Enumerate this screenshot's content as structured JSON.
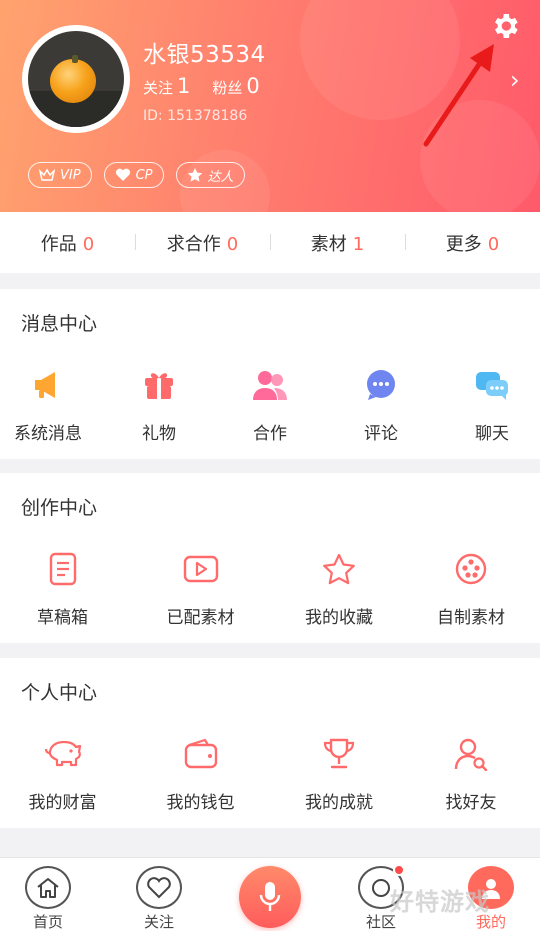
{
  "profile": {
    "username": "水银53534",
    "following_label": "关注",
    "following_count": "1",
    "fans_label": "粉丝",
    "fans_count": "0",
    "user_id": "ID: 151378186",
    "settings_icon": "gear-icon",
    "chevron": "›"
  },
  "badges": [
    {
      "label": "VIP",
      "icon": "crown-icon"
    },
    {
      "label": "CP",
      "icon": "heart-icon"
    },
    {
      "label": "达人",
      "icon": "star-icon"
    }
  ],
  "works_bar": [
    {
      "label": "作品",
      "count": "0"
    },
    {
      "label": "求合作",
      "count": "0"
    },
    {
      "label": "素材",
      "count": "1"
    },
    {
      "label": "更多",
      "count": "0"
    }
  ],
  "message_center": {
    "title": "消息中心",
    "items": [
      {
        "label": "系统消息",
        "icon": "megaphone-icon"
      },
      {
        "label": "礼物",
        "icon": "gift-icon"
      },
      {
        "label": "合作",
        "icon": "users-icon"
      },
      {
        "label": "评论",
        "icon": "comment-icon"
      },
      {
        "label": "聊天",
        "icon": "chat-icon"
      }
    ]
  },
  "creation_center": {
    "title": "创作中心",
    "items": [
      {
        "label": "草稿箱",
        "icon": "draft-icon"
      },
      {
        "label": "已配素材",
        "icon": "video-icon"
      },
      {
        "label": "我的收藏",
        "icon": "star-outline-icon"
      },
      {
        "label": "自制素材",
        "icon": "film-reel-icon"
      }
    ]
  },
  "personal_center": {
    "title": "个人中心",
    "items": [
      {
        "label": "我的财富",
        "icon": "piggy-bank-icon"
      },
      {
        "label": "我的钱包",
        "icon": "wallet-icon"
      },
      {
        "label": "我的成就",
        "icon": "trophy-icon"
      },
      {
        "label": "找好友",
        "icon": "find-friend-icon"
      }
    ]
  },
  "tabbar": {
    "home": "首页",
    "follow": "关注",
    "community": "社区",
    "mine": "我的"
  },
  "watermark": "好特游戏",
  "colors": {
    "accent": "#ff6a5d",
    "header_start": "#ffa36e",
    "header_end": "#ff5a6a"
  }
}
